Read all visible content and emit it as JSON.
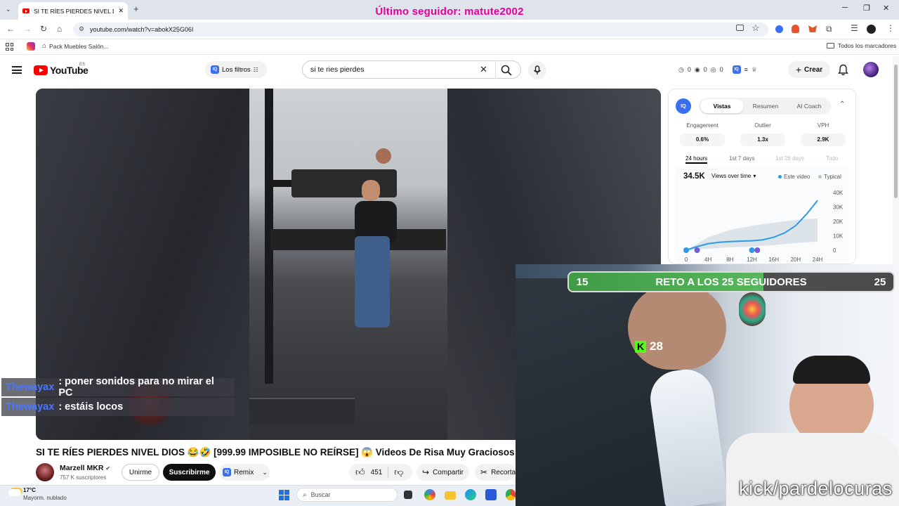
{
  "browser": {
    "tab_title": "SI TE RÍES PIERDES NIVEL DIOS",
    "new_tab_glyph": "+",
    "url": "youtube.com/watch?v=abokX25G06I",
    "bookmarks": {
      "item": "Pack Muebles Salón...",
      "all_bookmarks": "Todos los marcadores"
    }
  },
  "overlay": {
    "follower_text": "Último seguidor: matute2002",
    "goal": {
      "current": "15",
      "title": "RETO A LOS 25 SEGUIDORES",
      "target": "25",
      "progress": 0.6
    },
    "kick_count": "28",
    "watermark": "kick/pardelocuras",
    "chat": [
      {
        "user": "Thewayax",
        "message": ": poner sonidos para no mirar el PC"
      },
      {
        "user": "Thewayax",
        "message": ": estáis locos"
      }
    ]
  },
  "youtube": {
    "logo_text": "YouTube",
    "locale": "ES",
    "filters_label": "Los filtros",
    "search_value": "si te ries pierdes",
    "stats": [
      "0",
      "0",
      "0"
    ],
    "create_label": "Crear",
    "video_title": "SI TE RÍES PIERDES NIVEL DIOS 😂🤣 [999.99 IMPOSIBLE NO REÍRSE] 😱 Videos De Risa Muy Graciosos",
    "channel_name": "Marzell MKR",
    "channel_subs": "757 K suscriptores",
    "join_label": "Unirme",
    "subscribe_label": "Suscribirme",
    "remix_label": "Remix",
    "likes": "451",
    "share_label": "Compartir",
    "clip_label": "Recorta"
  },
  "analytics_panel": {
    "tabs": [
      "Vistas",
      "Resumen",
      "AI Coach"
    ],
    "metrics": [
      {
        "label": "Engagement",
        "value": "0.6%"
      },
      {
        "label": "Outlier",
        "value": "1.3x"
      },
      {
        "label": "VPH",
        "value": "2.9K"
      }
    ],
    "ranges": [
      "24 hours",
      "1st 7 days",
      "1st 28 days",
      "Todo"
    ],
    "total_views": "34.5K",
    "views_dropdown": "Views over time",
    "legend": {
      "this_video": "Este video",
      "typical": "Typical"
    },
    "colors": {
      "this_video": "#2b9be8",
      "typical": "#b9c6d2"
    }
  },
  "chart_data": {
    "type": "line",
    "x_ticks": [
      "0",
      "4H",
      "8H",
      "12H",
      "16H",
      "20H",
      "24H"
    ],
    "y_ticks": [
      "40K",
      "30K",
      "20K",
      "10K",
      "0"
    ],
    "ylim": [
      0,
      40000
    ],
    "series": [
      {
        "name": "Este video",
        "x": [
          0,
          2,
          4,
          6,
          8,
          10,
          12,
          14,
          16,
          18,
          20,
          22,
          24
        ],
        "values": [
          0,
          2500,
          4500,
          5500,
          6000,
          6300,
          6500,
          7200,
          9000,
          12000,
          17000,
          25000,
          34500
        ]
      },
      {
        "name": "Typical",
        "x": [
          0,
          4,
          8,
          12,
          16,
          20,
          24
        ],
        "values_low": [
          0,
          1000,
          2000,
          2500,
          3500,
          5000,
          6000
        ],
        "values_high": [
          0,
          9000,
          14000,
          17000,
          19000,
          21000,
          22000
        ]
      }
    ]
  },
  "taskbar": {
    "weather_temp": "17°C",
    "weather_desc": "Mayorm. nublado",
    "search_placeholder": "Buscar"
  }
}
